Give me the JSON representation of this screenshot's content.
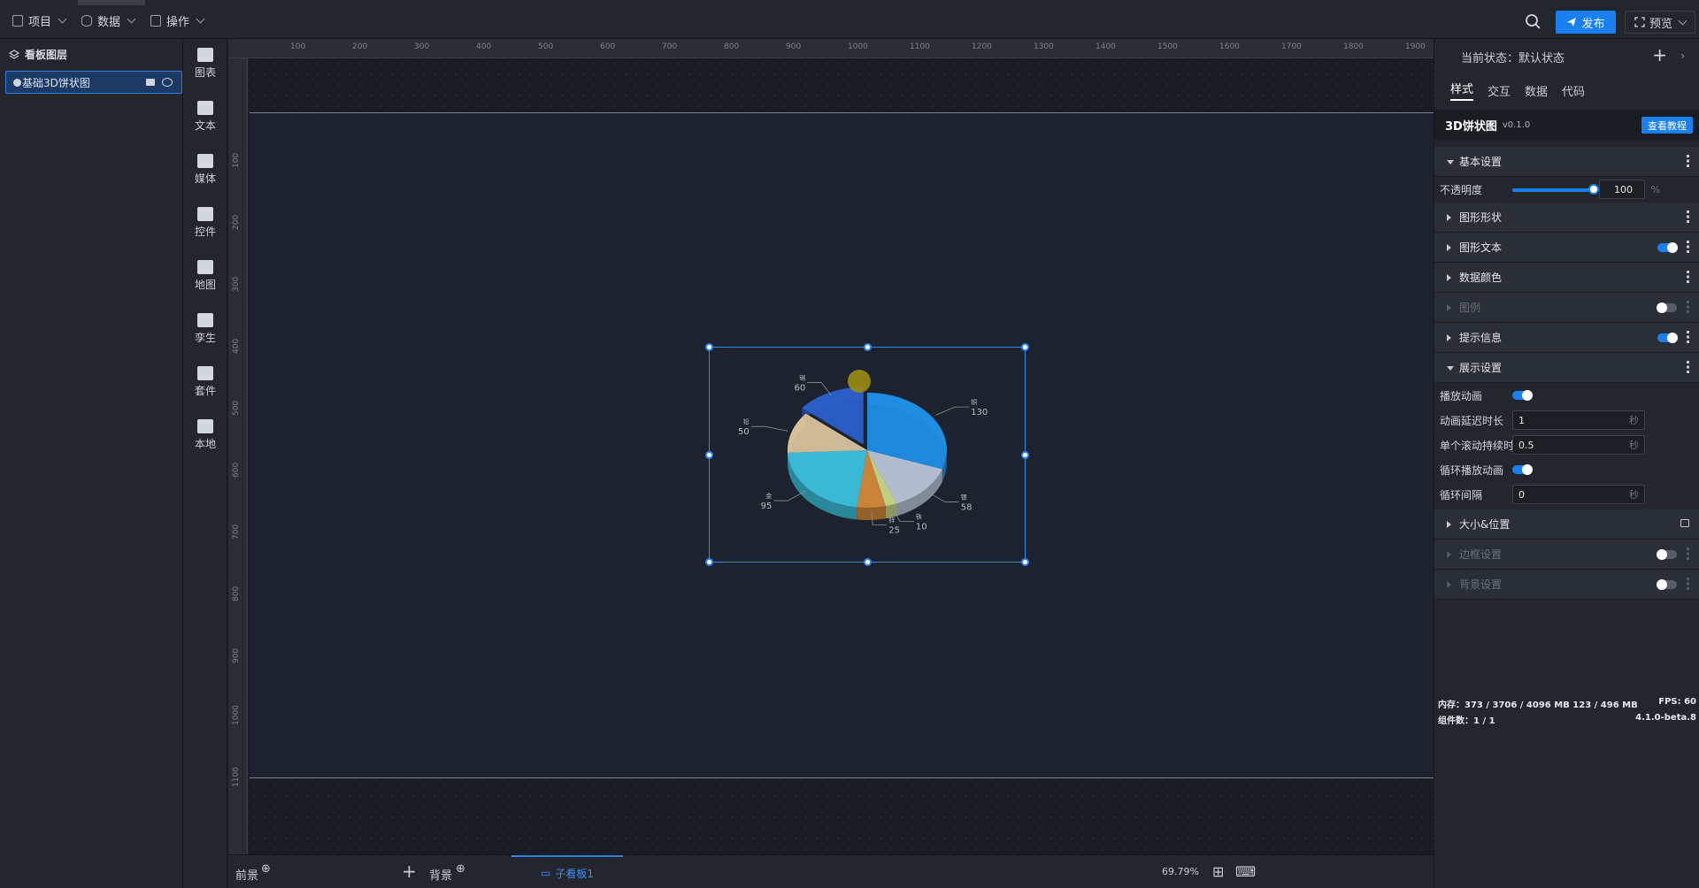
{
  "topbar": {
    "menu_project": "项目",
    "menu_data": "数据",
    "menu_ops": "操作",
    "publish": "发布",
    "preview": "预览"
  },
  "layers": {
    "title": "看板图层",
    "item": "基础3D饼状图"
  },
  "tools": [
    "图表",
    "文本",
    "媒体",
    "控件",
    "地图",
    "孪生",
    "套件",
    "本地"
  ],
  "ruler_top_ticks": [
    "100",
    "200",
    "300",
    "400",
    "500",
    "600",
    "700",
    "800",
    "900",
    "1000",
    "1100",
    "1200",
    "1300",
    "1400",
    "1500",
    "1600",
    "1700",
    "1800",
    "1900"
  ],
  "ruler_left_ticks": [
    "100",
    "200",
    "300",
    "400",
    "500",
    "600",
    "700",
    "800",
    "900",
    "1000",
    "1100"
  ],
  "chart_data": {
    "type": "pie",
    "categories": [
      "铜",
      "银",
      "铁",
      "锌",
      "金",
      "铅",
      "锡"
    ],
    "values": [
      130,
      58,
      10,
      25,
      95,
      50,
      60
    ],
    "colors": [
      "#1f8fe6",
      "#b7c6d8",
      "#c9d88a",
      "#d48a3a",
      "#3cc2de",
      "#d9c39e",
      "#2b5fc8"
    ],
    "title": ""
  },
  "bottombar": {
    "front": "前景",
    "board_tab": "子看板1",
    "back": "背景",
    "zoom": "69.79%"
  },
  "panel": {
    "state_label": "当前状态：",
    "state_value": "默认状态",
    "tabs": [
      "样式",
      "交互",
      "数据",
      "代码"
    ],
    "comp_name": "3D饼状图",
    "comp_version": "v0.1.0",
    "tutorial": "查看教程",
    "basic": "基本设置",
    "opacity_label": "不透明度",
    "opacity_value": "100",
    "opacity_unit": "%",
    "opacity_level": 1.0,
    "shape": "图形形状",
    "shape_text": "图形文本",
    "data_color": "数据颜色",
    "legend": "图例",
    "tooltip": "提示信息",
    "display": "展示设置",
    "play_anim": "播放动画",
    "delay_label": "动画延迟时长",
    "delay_value": "1",
    "sec_unit": "秒",
    "scroll_label": "单个滚动持续时长",
    "scroll_value": "0.5",
    "loop_label": "循环播放动画",
    "interval_label": "循环间隔",
    "interval_value": "0",
    "size_pos": "大小&位置",
    "border": "边框设置",
    "background": "背景设置"
  },
  "status": {
    "memory": "内存：373 / 3706 / 4096 MB  123 / 496 MB",
    "fps": "FPS:  60",
    "components": "组件数：1 / 1",
    "version": "4.1.0-beta.8"
  }
}
